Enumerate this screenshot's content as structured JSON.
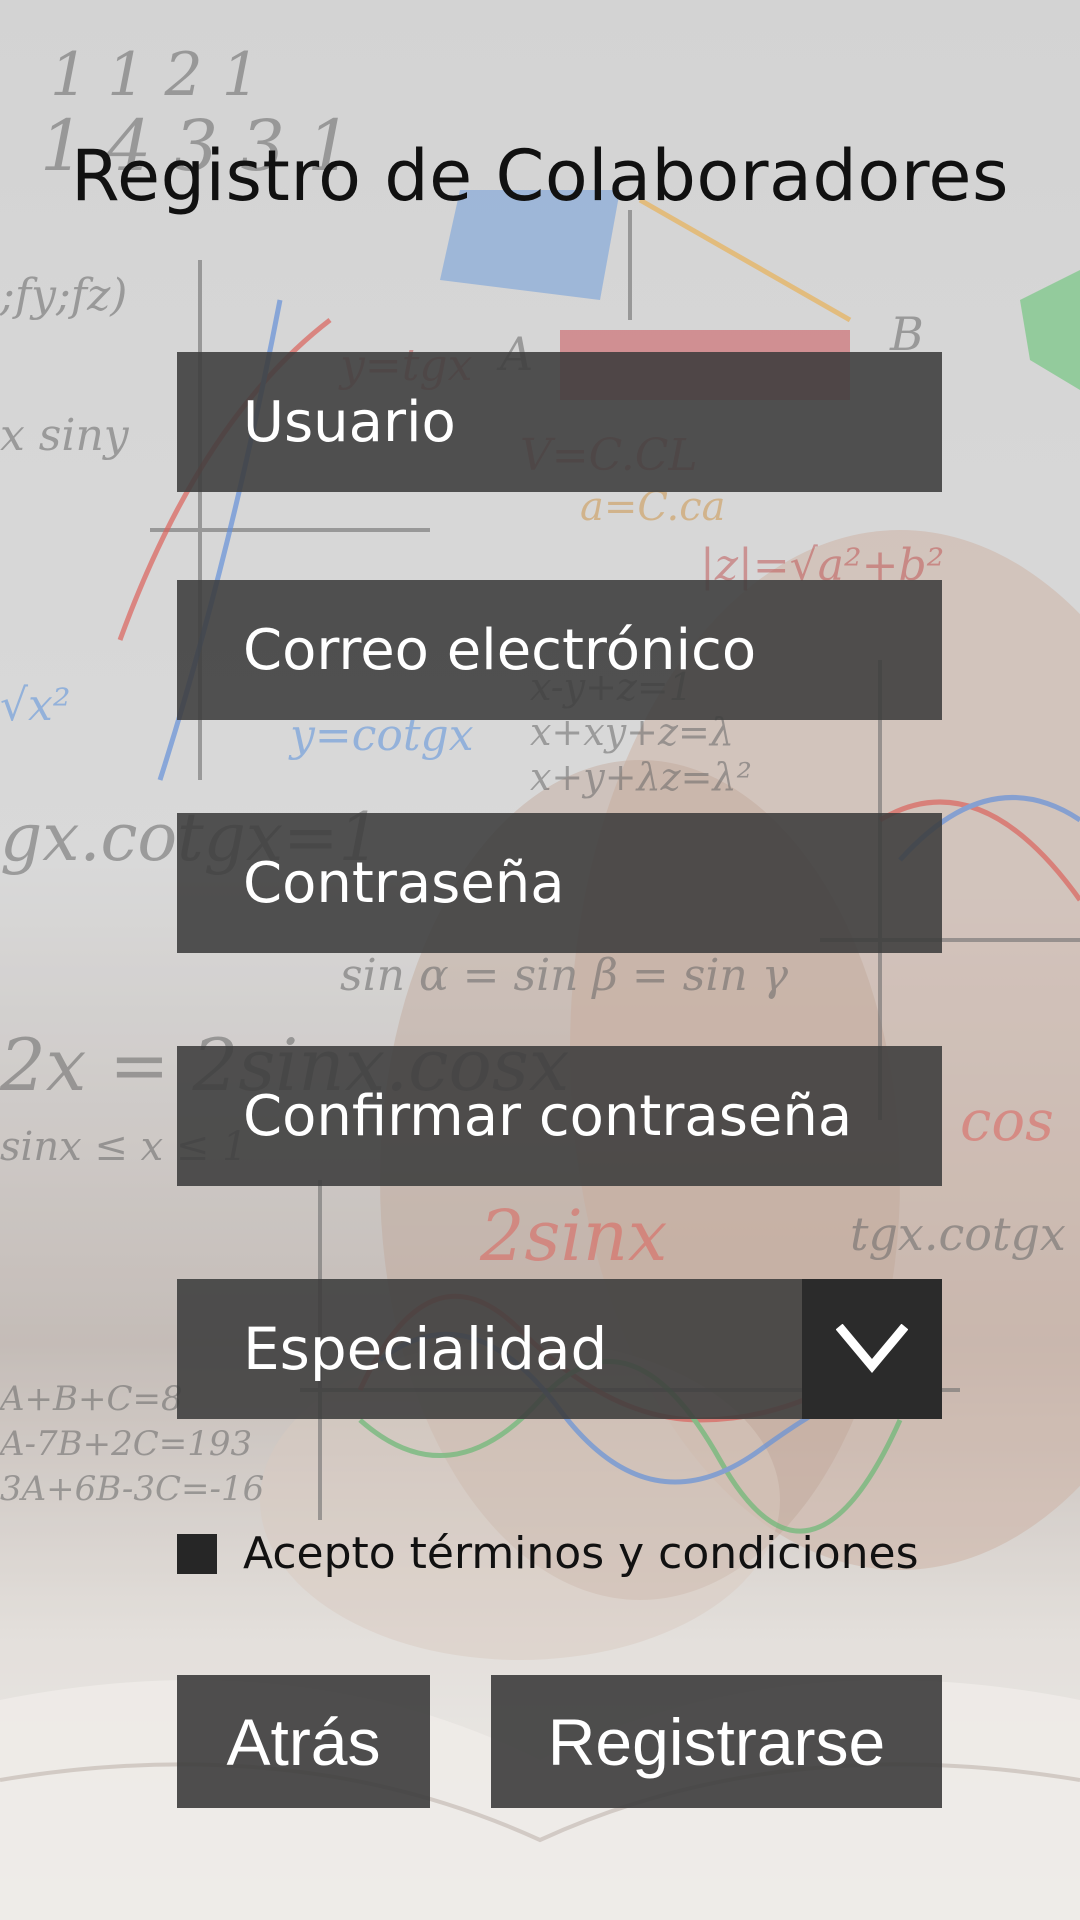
{
  "page": {
    "title": "Registro de Colaboradores"
  },
  "form": {
    "username_placeholder": "Usuario",
    "email_placeholder": "Correo electrónico",
    "password_placeholder": "Contraseña",
    "confirm_password_placeholder": "Confirmar contraseña",
    "specialty_selected": "Especialidad",
    "terms_label": "Acepto términos y condiciones",
    "terms_checked": false
  },
  "actions": {
    "back_label": "Atrás",
    "register_label": "Registrarse"
  },
  "icons": {
    "dropdown": "chevron-down-icon",
    "background": "math-formulas-background"
  },
  "colors": {
    "field_background": "#3c3c3c",
    "dropdown_button": "#2b2b2b",
    "text_light": "#ffffff",
    "text_dark": "#111111"
  }
}
